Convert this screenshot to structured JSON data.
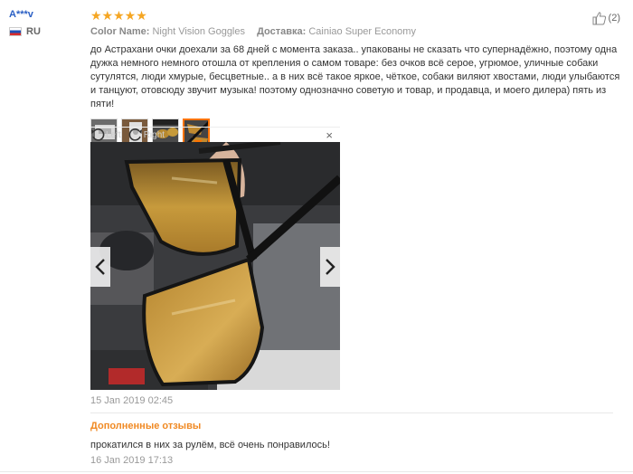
{
  "user": {
    "name": "A***v",
    "country_code": "RU"
  },
  "review": {
    "stars": "★★★★★",
    "color_label": "Color Name:",
    "color_value": "Night Vision Goggles",
    "shipping_label": "Доставка:",
    "shipping_value": "Cainiao Super Economy",
    "likes": "(2)",
    "text": "до Астрахани очки доехали за 68 дней с момента заказа.. упакованы не сказать что супернадёжно, поэтому одна дужка немного немного отошла от крепления о самом товаре: без очков всё серое, угрюмое, уличные собаки сутулятся, люди хмурые, бесцветные.. а в них всё такое яркое, чёткое, собаки виляют хвостами, люди улыбаются и танцуют, отовсюду звучит музыка! поэтому однозначно советую и товар, и продавца, и моего дилера) пять из пяти!",
    "date": "15 Jan 2019 02:45"
  },
  "viewer": {
    "left_label": "Left",
    "right_label": "Right",
    "close": "×"
  },
  "additional": {
    "title": "Дополненные отзывы",
    "text": "прокатился в них за рулём, всё очень понравилось!",
    "date": "16 Jan 2019 17:13"
  }
}
